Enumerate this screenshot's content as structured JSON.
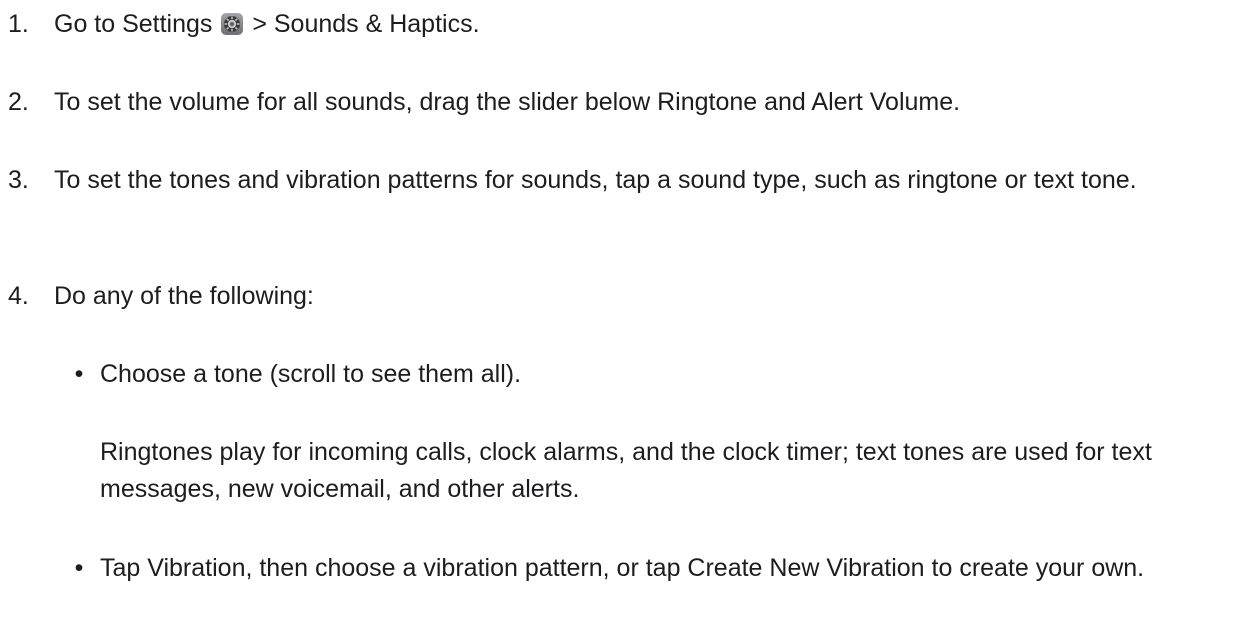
{
  "steps": [
    {
      "number": "1.",
      "text_before_icon": "Go to Settings ",
      "icon": "settings-gear-icon",
      "text_after_icon": " > Sounds & Haptics."
    },
    {
      "number": "2.",
      "text": "To set the volume for all sounds, drag the slider below Ringtone and Alert Volume."
    },
    {
      "number": "3.",
      "text": "To set the tones and vibration patterns for sounds, tap a sound type, such as ringtone or text tone."
    },
    {
      "number": "4.",
      "text": "Do any of the following:"
    }
  ],
  "bullets": [
    {
      "marker": "•",
      "text": "Choose a tone (scroll to see them all).",
      "note": "Ringtones play for incoming calls, clock alarms, and the clock timer; text tones are used for text messages, new voicemail, and other alerts."
    },
    {
      "marker": "•",
      "text": "Tap Vibration, then choose a vibration pattern, or tap Create New Vibration to create your own."
    }
  ],
  "colors": {
    "text": "#1d1d1f",
    "background": "#ffffff",
    "icon_gray": "#8e8e93"
  }
}
